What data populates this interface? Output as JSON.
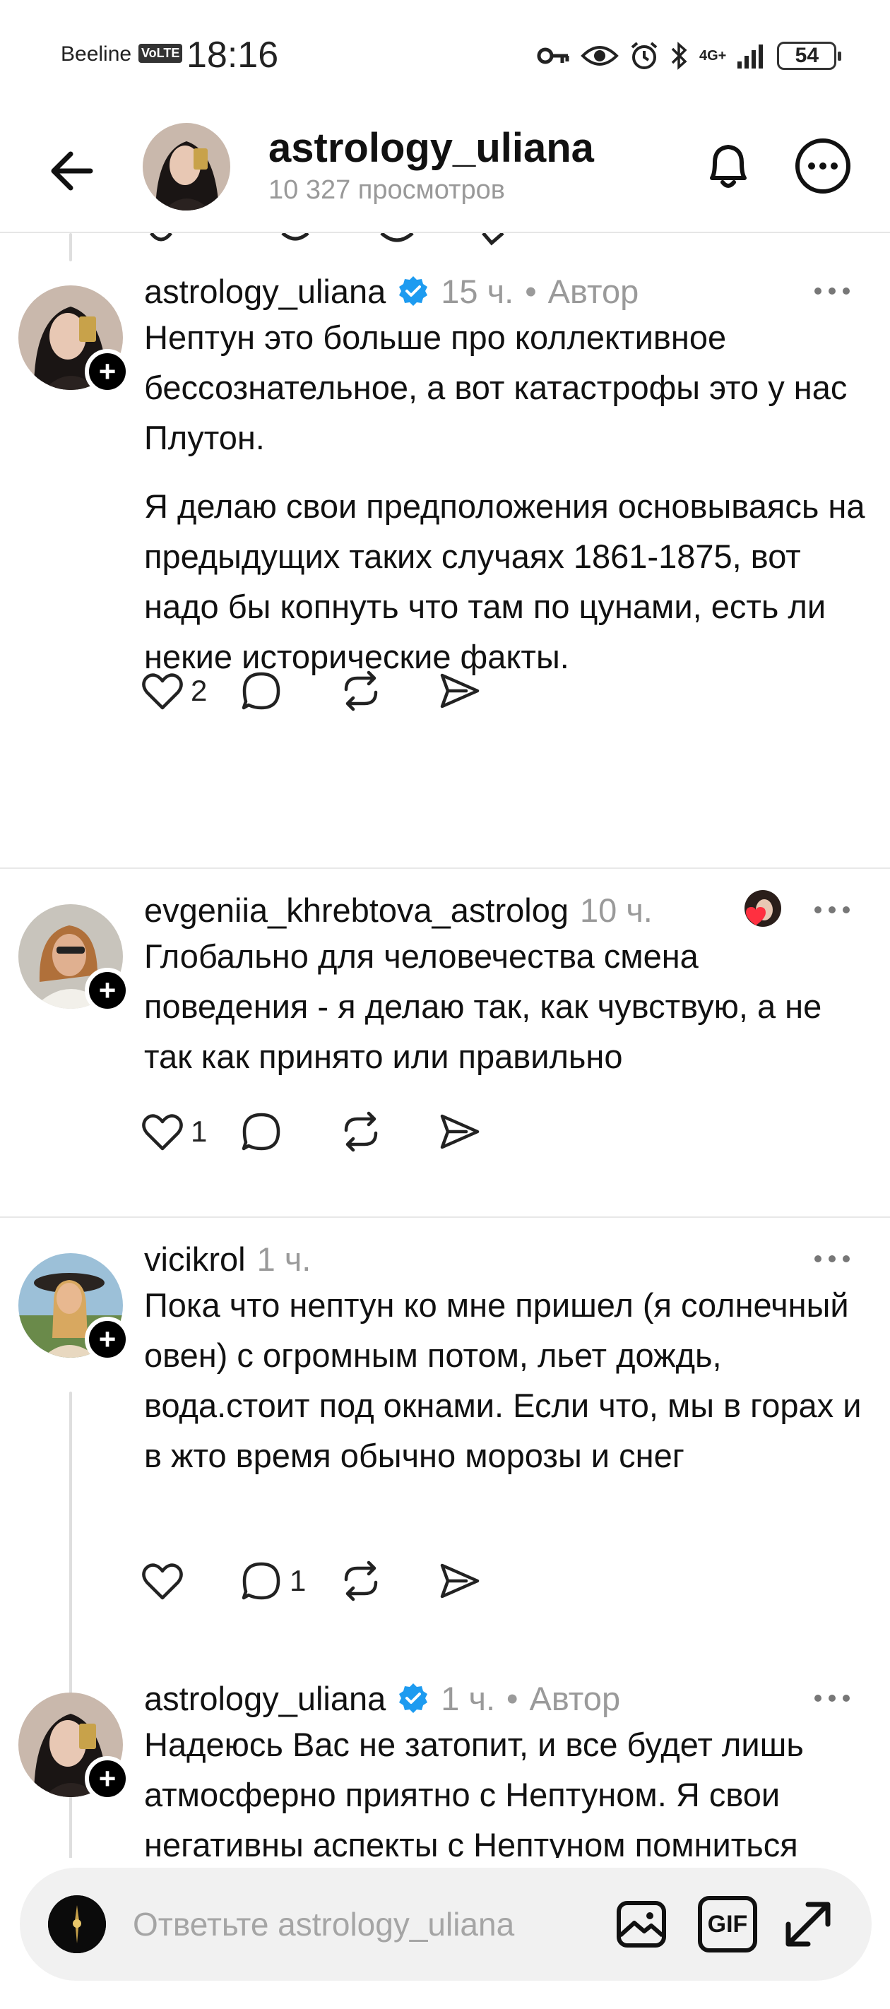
{
  "status_bar": {
    "carrier": "Beeline",
    "volte": "VoLTE",
    "time": "18:16",
    "network": "4G+",
    "battery": "54",
    "icons": [
      "key-icon",
      "eye-icon",
      "alarm-icon",
      "bluetooth-icon",
      "signal-icon",
      "battery-icon"
    ]
  },
  "header": {
    "title": "astrology_uliana",
    "subtitle": "10 327 просмотров"
  },
  "posts": [
    {
      "username": "astrology_uliana",
      "verified": true,
      "age": "15 ч.",
      "dot": "•",
      "author_badge": "Автор",
      "paragraphs": [
        "Нептун это больше про коллективное бессознательное, а вот катастрофы это у нас Плутон.",
        "Я делаю свои предположения основываясь на предыдущих таких случаях 1861-1875, вот надо бы копнуть что там по цунами, есть ли некие исторические факты."
      ],
      "likes": "2",
      "replies": ""
    },
    {
      "username": "evgeniia_khrebtova_astrolog",
      "verified": false,
      "age": "10 ч.",
      "paragraphs": [
        "Глобально для человечества смена поведения - я делаю так, как чувствую, а не так как принято или правильно"
      ],
      "likes": "1",
      "replies": ""
    },
    {
      "username": "vicikrol",
      "verified": false,
      "age": "1 ч.",
      "paragraphs": [
        "Пока что нептун ко мне пришел (я солнечный овен) с огромным потом, льет дождь, вода.стоит под окнами. Если что, мы в горах и в жто время обычно морозы и снег"
      ],
      "likes": "",
      "replies": "1"
    },
    {
      "username": "astrology_uliana",
      "verified": true,
      "age": "1 ч.",
      "dot": "•",
      "author_badge": "Автор",
      "paragraphs": [
        "Надеюсь Вас не затопит, и все будет лишь атмосферно приятно с Нептуном. Я свои негативны аспекты с Нептуном помниться"
      ],
      "likes": "",
      "replies": ""
    }
  ],
  "reply_bar": {
    "placeholder": "Ответьте astrology_uliana",
    "gif_label": "GIF"
  },
  "colors": {
    "verified_blue": "#1d9bf0",
    "like_heart_red": "#ff3040",
    "muted_text": "#9a9a9a"
  }
}
